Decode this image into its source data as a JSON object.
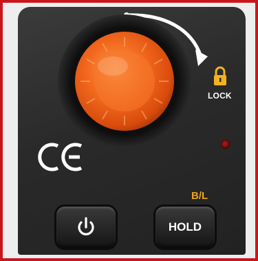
{
  "device_panel": {
    "lock_label": "LOCK",
    "backlight_label": "B/L",
    "hold_label": "HOLD",
    "ce_mark": "CE"
  },
  "icons": {
    "knob": "rotary-knob",
    "rotation_arrow": "rotation-arrow-icon",
    "lock": "padlock-icon",
    "power": "power-icon",
    "indicator": "status-led"
  },
  "colors": {
    "frame": "#c9161c",
    "panel": "#2b2b2b",
    "knob_orange": "#f26a1f",
    "backlight_label": "#f0a21b",
    "lock_icon": "#f3b31e",
    "led": "#8e1010"
  }
}
